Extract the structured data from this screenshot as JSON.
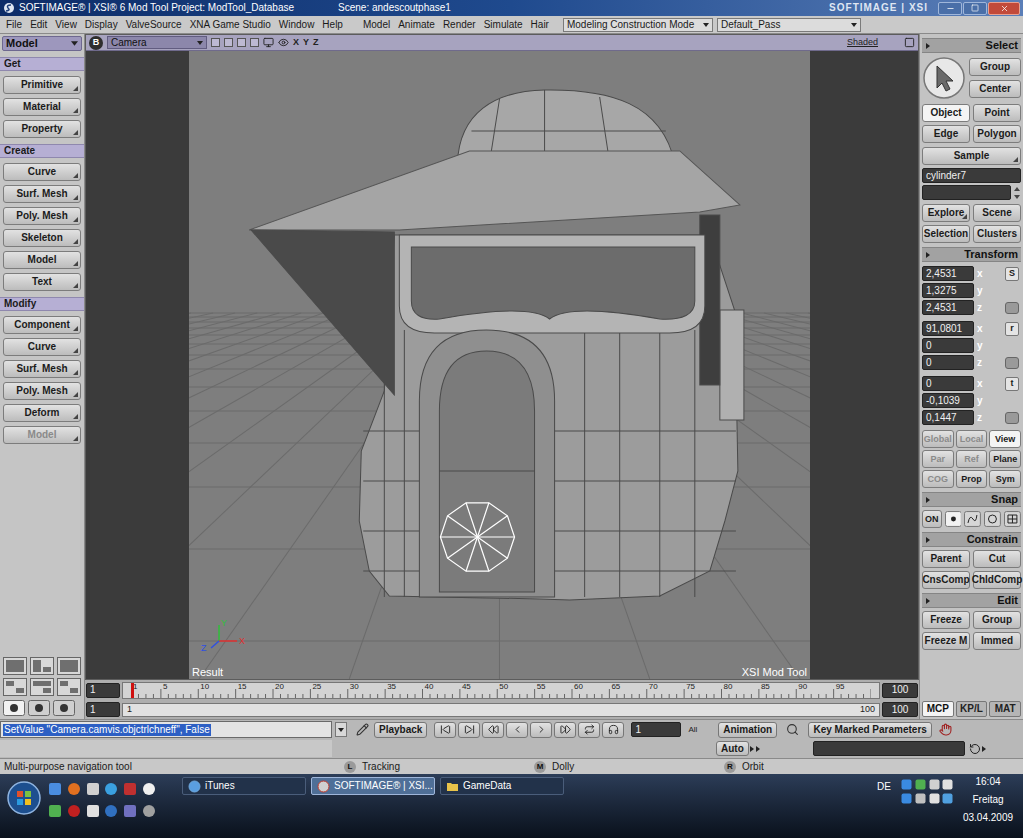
{
  "window": {
    "title": "SOFTIMAGE® | XSI® 6 Mod Tool Project: ModTool_Database",
    "scene": "Scene: andescoutphase1",
    "brand": "SOFTIMAGE | XSI"
  },
  "menu": {
    "main": [
      "File",
      "Edit",
      "View",
      "Display",
      "ValveSource",
      "XNA Game Studio",
      "Window",
      "Help"
    ],
    "modules": [
      "Model",
      "Animate",
      "Render",
      "Simulate",
      "Hair"
    ],
    "mode": "Modeling Construction Mode",
    "pass": "Default_Pass"
  },
  "left_panel": {
    "module": "Model",
    "sections": [
      {
        "title": "Get",
        "buttons": [
          {
            "label": "Primitive",
            "disabled": false
          },
          {
            "label": "Material",
            "disabled": false
          },
          {
            "label": "Property",
            "disabled": false
          }
        ]
      },
      {
        "title": "Create",
        "buttons": [
          {
            "label": "Curve",
            "disabled": false
          },
          {
            "label": "Surf. Mesh",
            "disabled": false
          },
          {
            "label": "Poly. Mesh",
            "disabled": false
          },
          {
            "label": "Skeleton",
            "disabled": false
          },
          {
            "label": "Model",
            "disabled": false
          },
          {
            "label": "Text",
            "disabled": false
          }
        ]
      },
      {
        "title": "Modify",
        "buttons": [
          {
            "label": "Component",
            "disabled": false
          },
          {
            "label": "Curve",
            "disabled": false
          },
          {
            "label": "Surf. Mesh",
            "disabled": false
          },
          {
            "label": "Poly. Mesh",
            "disabled": false
          },
          {
            "label": "Deform",
            "disabled": false
          },
          {
            "label": "Model",
            "disabled": true
          }
        ]
      }
    ]
  },
  "viewport": {
    "tag": "B",
    "camera": "Camera",
    "axes": [
      "X",
      "Y",
      "Z"
    ],
    "shading": "Shaded",
    "mode_label": "Result",
    "product": "XSI Mod Tool",
    "gizmo": [
      "Y",
      "Z",
      "X"
    ]
  },
  "timeline": {
    "start": "1",
    "end": "100",
    "range_in": "1",
    "range_out": "100",
    "range_start": "1",
    "range_end": "100",
    "ticks": [
      "1",
      "5",
      "10",
      "15",
      "20",
      "25",
      "30",
      "35",
      "40",
      "45",
      "50",
      "55",
      "60",
      "65",
      "70",
      "75",
      "80",
      "85",
      "90",
      "95"
    ],
    "playhead": {
      "level": 0
    }
  },
  "command_line": {
    "text": "SetValue \"Camera.camvis.objctrlchneff\", False",
    "selected": true
  },
  "playback": {
    "label": "Playback",
    "frame": "1",
    "range": "All",
    "animation": "Animation",
    "auto": "Auto",
    "key_marked": "Key Marked Parameters"
  },
  "status_bar": {
    "message": "Multi-purpose navigation tool",
    "mouse": [
      {
        "button": "L",
        "action": "Tracking"
      },
      {
        "button": "M",
        "action": "Dolly"
      },
      {
        "button": "R",
        "action": "Orbit"
      }
    ]
  },
  "right_panel": {
    "select": {
      "title": "Select",
      "buttons": [
        "Group",
        "Center"
      ],
      "filters": [
        {
          "label": "Object",
          "selected": true
        },
        {
          "label": "Point",
          "selected": false
        },
        {
          "label": "Edge",
          "selected": false
        },
        {
          "label": "Polygon",
          "selected": false
        }
      ],
      "sample": "Sample",
      "selection": "cylinder7",
      "explore": [
        "Explore",
        "Scene",
        "Selection",
        "Clusters"
      ]
    },
    "transform": {
      "title": "Transform",
      "groups": [
        {
          "kind": "scale",
          "icon": "S",
          "values": [
            {
              "axis": "x",
              "value": "2,4531"
            },
            {
              "axis": "y",
              "value": "1,3275"
            },
            {
              "axis": "z",
              "value": "2,4531"
            }
          ]
        },
        {
          "kind": "rotation",
          "icon": "r",
          "values": [
            {
              "axis": "x",
              "value": "91,0801"
            },
            {
              "axis": "y",
              "value": "0"
            },
            {
              "axis": "z",
              "value": "0"
            }
          ]
        },
        {
          "kind": "translation",
          "icon": "t",
          "values": [
            {
              "axis": "x",
              "value": "0"
            },
            {
              "axis": "y",
              "value": "-0,1039"
            },
            {
              "axis": "z",
              "value": "0,1447"
            }
          ]
        }
      ],
      "references": [
        {
          "label": "Global",
          "selected": false,
          "disabled": true
        },
        {
          "label": "Local",
          "selected": false,
          "disabled": true
        },
        {
          "label": "View",
          "selected": true,
          "disabled": false
        },
        {
          "label": "Par",
          "selected": false,
          "disabled": true
        },
        {
          "label": "Ref",
          "selected": false,
          "disabled": true
        },
        {
          "label": "Plane",
          "selected": false,
          "disabled": false
        },
        {
          "label": "COG",
          "selected": false,
          "disabled": true
        },
        {
          "label": "Prop",
          "selected": false,
          "disabled": false
        },
        {
          "label": "Sym",
          "selected": false,
          "disabled": false
        }
      ]
    },
    "snap": {
      "title": "Snap",
      "on": "ON"
    },
    "constrain": {
      "title": "Constrain",
      "buttons": [
        "Parent",
        "Cut",
        "CnsComp",
        "ChldComp"
      ]
    },
    "edit": {
      "title": "Edit",
      "buttons": [
        "Freeze",
        "Group",
        "Freeze M",
        "Immed"
      ]
    },
    "tabs": [
      {
        "label": "MCP",
        "selected": true
      },
      {
        "label": "KP/L",
        "selected": false
      },
      {
        "label": "MAT",
        "selected": false
      }
    ]
  },
  "taskbar": {
    "tasks": [
      {
        "label": "iTunes",
        "selected": false
      },
      {
        "label": "SOFTIMAGE® | XSI...",
        "selected": true
      },
      {
        "label": "GameData",
        "selected": false
      }
    ],
    "language": "DE",
    "time": "16:04",
    "day": "Freitag",
    "date": "03.04.2009"
  }
}
